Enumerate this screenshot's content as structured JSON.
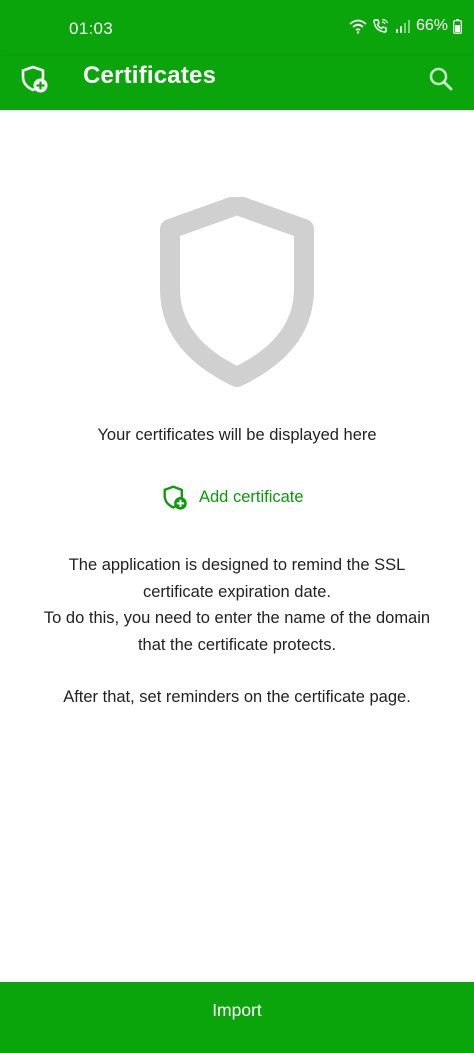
{
  "status_bar": {
    "time": "01:03",
    "battery": "66%",
    "icons": [
      "wifi-icon",
      "wifi-call-icon",
      "signal-icon",
      "battery-icon"
    ]
  },
  "app_bar": {
    "title": "Certificates",
    "logo_icon": "shield-plus-icon",
    "action_icon": "search-icon"
  },
  "empty_state": {
    "illustration_icon": "shield-outline-icon",
    "message": "Your certificates will be displayed here",
    "add_label": "Add certificate",
    "add_icon": "shield-plus-icon"
  },
  "info": {
    "line1": "The application is designed to remind the SSL",
    "line2": "certificate expiration date.",
    "line3": "To do this, you need to enter the name of the domain",
    "line4": "that the certificate protects.",
    "line5": "After that, set reminders on the certificate page."
  },
  "bottom": {
    "import_label": "Import"
  },
  "colors": {
    "primary": "#0aa50a",
    "accent_text": "#0a9a0a",
    "illustration": "#d0d0d0",
    "text": "#222222"
  }
}
